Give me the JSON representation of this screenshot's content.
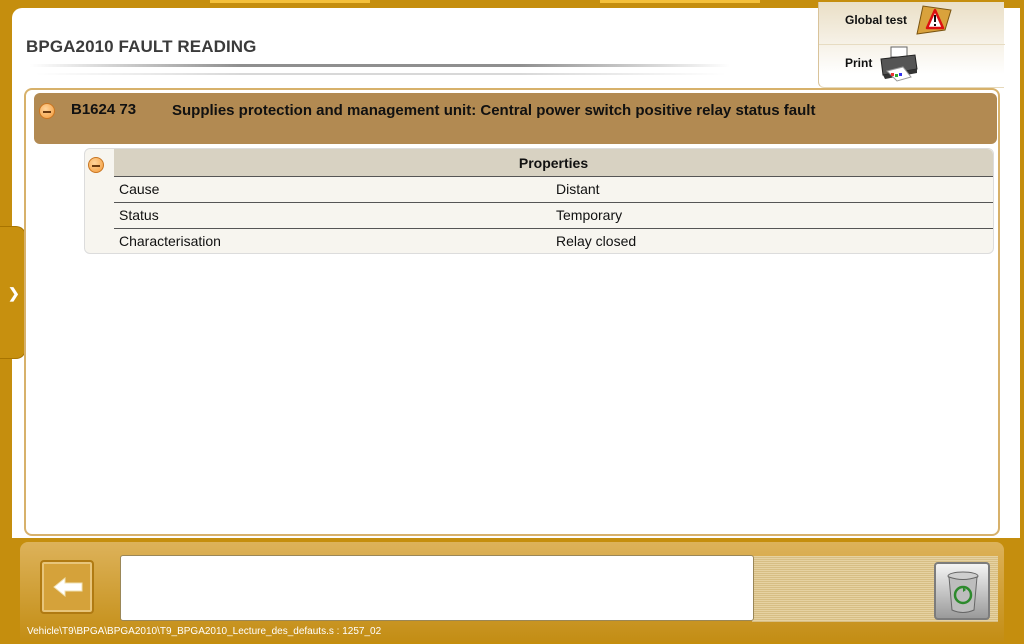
{
  "page": {
    "title": "BPGA2010  FAULT READING"
  },
  "toolbar": {
    "global_test_label": "Global test",
    "print_label": "Print"
  },
  "fault": {
    "code": "B1624 73",
    "description": "Supplies protection and management unit: Central power switch positive relay status fault"
  },
  "properties": {
    "header": "Properties",
    "rows": [
      {
        "key": "Cause",
        "value": "Distant"
      },
      {
        "key": "Status",
        "value": "Temporary"
      },
      {
        "key": "Characterisation",
        "value": "Relay closed"
      }
    ]
  },
  "footer": {
    "path": "Vehicle\\T9\\BPGA\\BPGA2010\\T9_BPGA2010_Lecture_des_defauts.s : 1257_02"
  },
  "colors": {
    "frame": "#c58e0e",
    "fault_header": "#b28a52",
    "props_header": "#d8d2c2",
    "accent_orange": "#f39a3a"
  },
  "icons": [
    "warning-icon",
    "printer-icon",
    "chevron-right-icon",
    "back-arrow-icon",
    "trash-icon",
    "collapse-icon"
  ]
}
